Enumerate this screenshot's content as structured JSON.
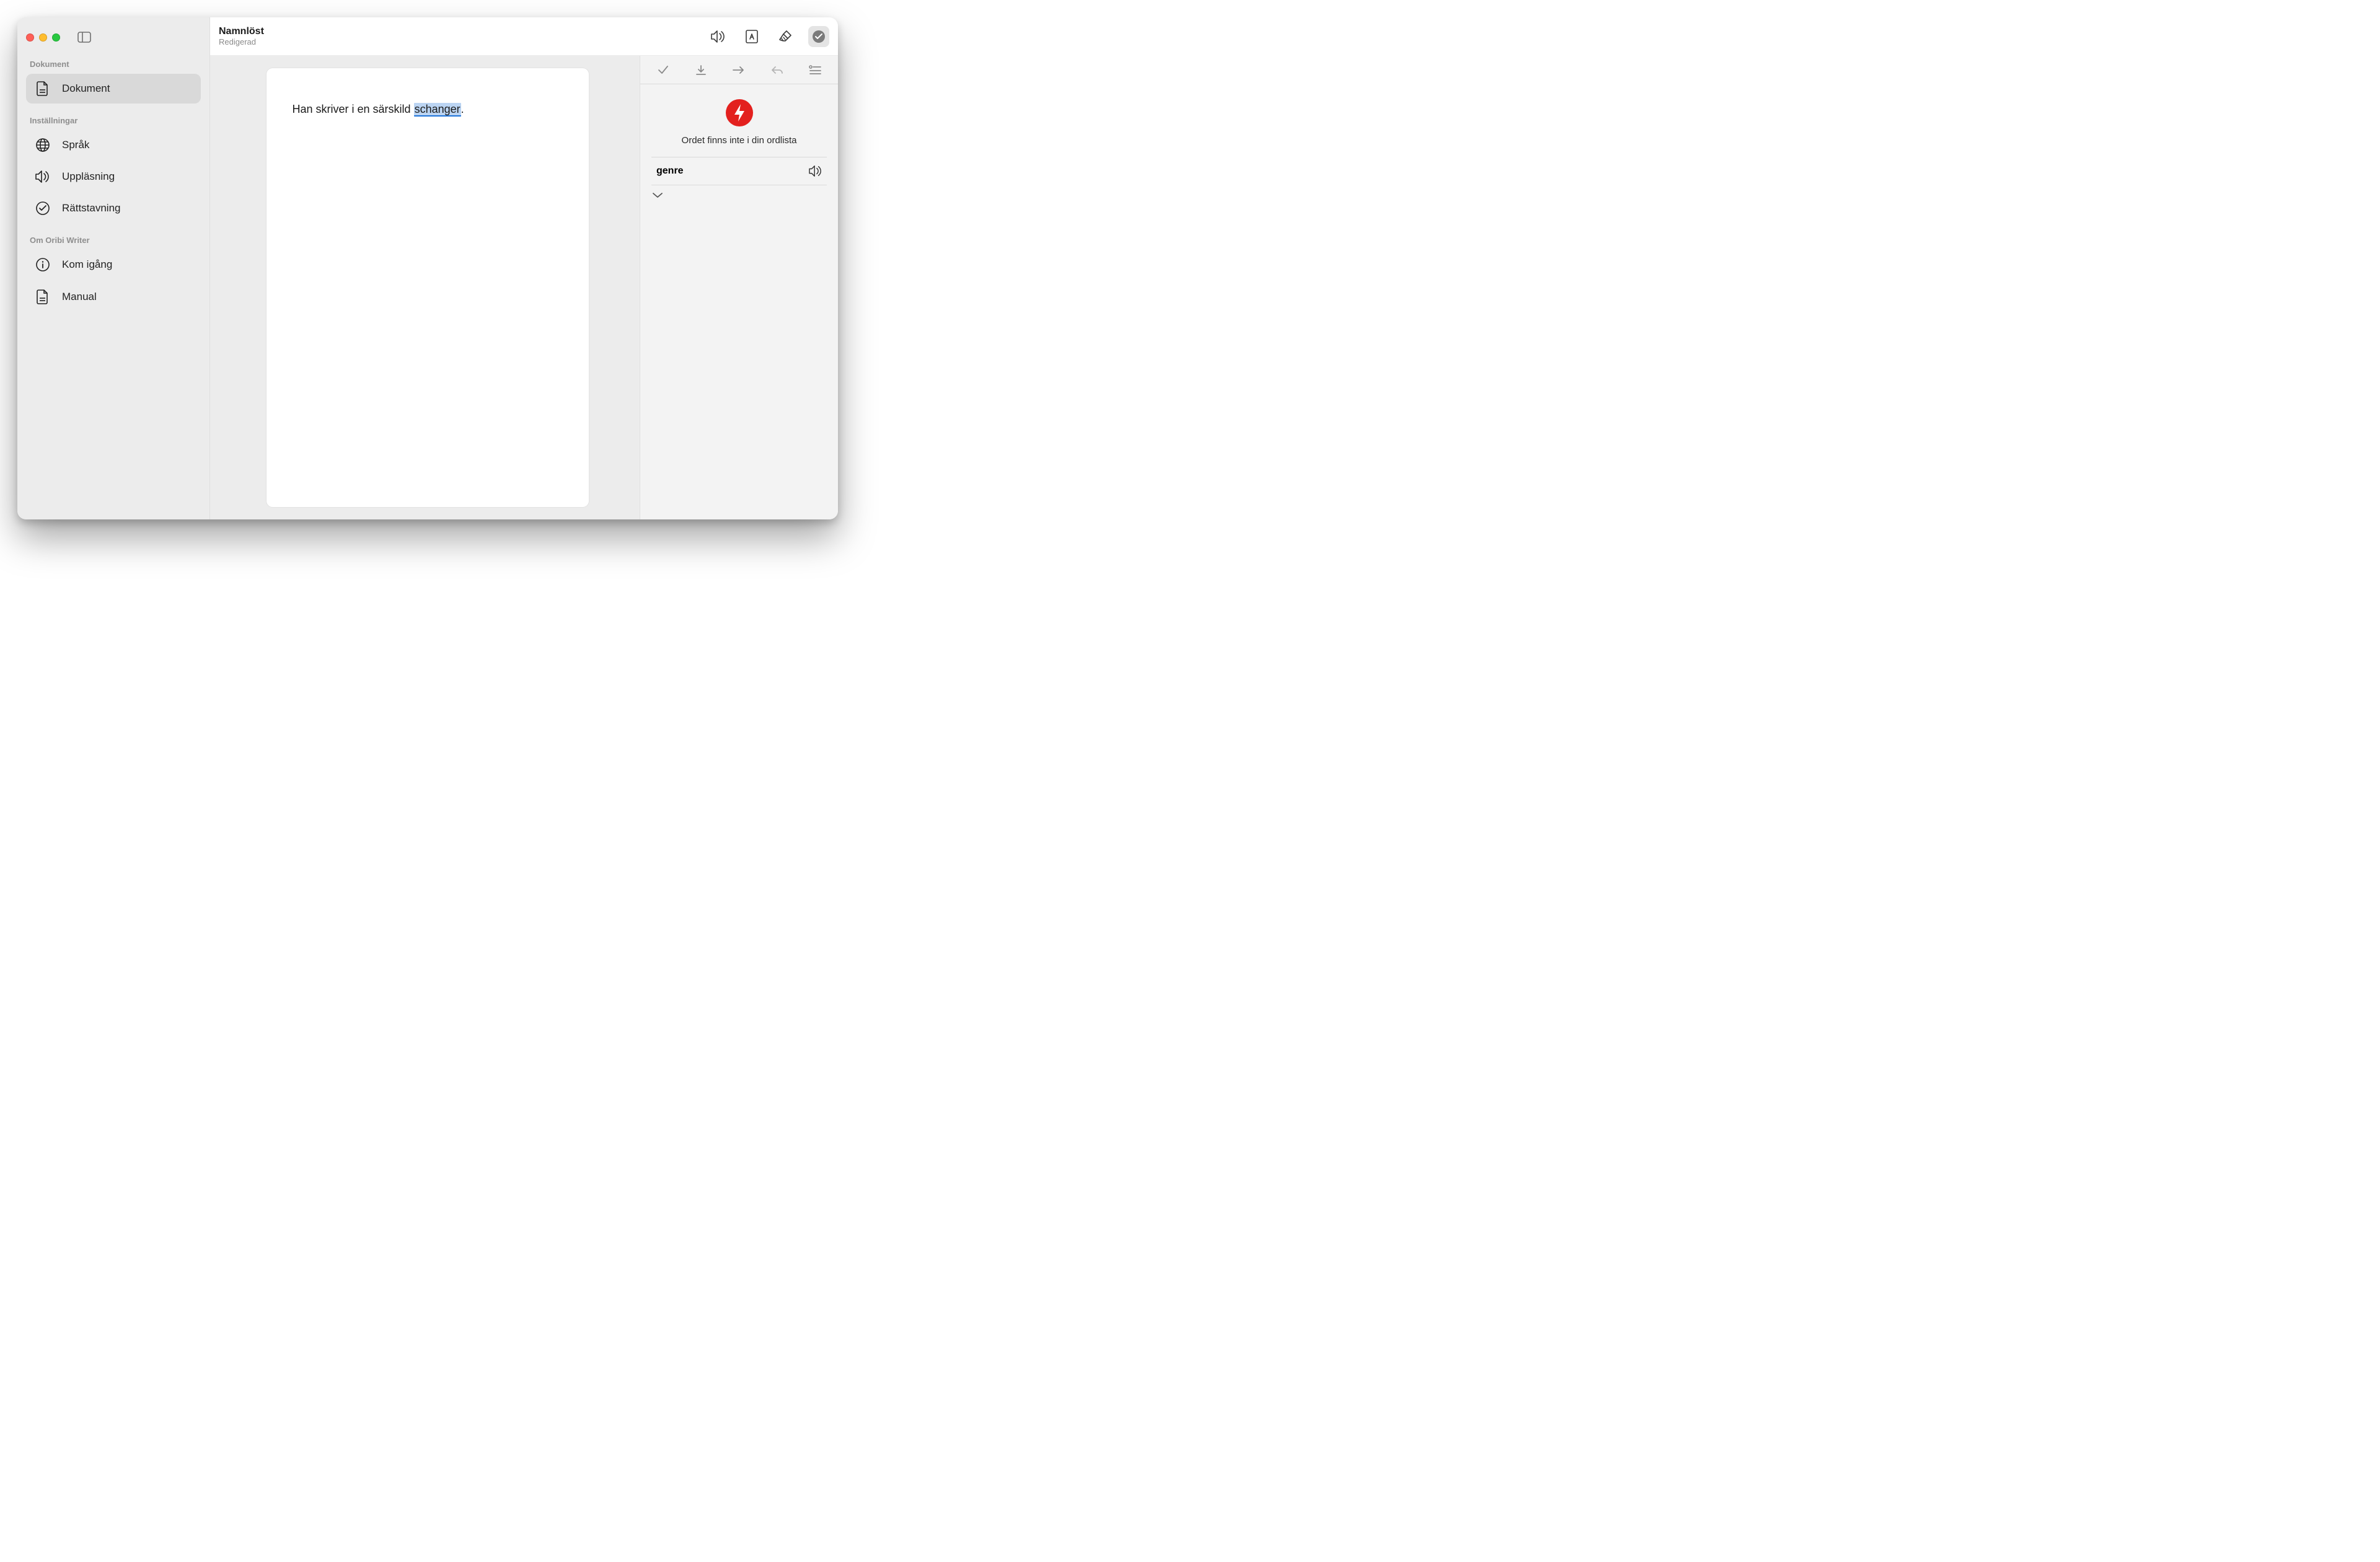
{
  "titlebar": {
    "title": "Namnlöst",
    "subtitle": "Redigerad"
  },
  "sidebar": {
    "sections": [
      {
        "label": "Dokument"
      },
      {
        "label": "Inställningar"
      },
      {
        "label": "Om Oribi Writer"
      }
    ],
    "items": {
      "dokument": "Dokument",
      "sprak": "Språk",
      "upplasning": "Uppläsning",
      "rattstavning": "Rättstavning",
      "kom_igang": "Kom igång",
      "manual": "Manual"
    }
  },
  "editor": {
    "text_before": "Han skriver i en särskild ",
    "highlighted": "schanger",
    "text_after": "."
  },
  "panel": {
    "message": "Ordet finns inte i din ordlista",
    "suggestion": "genre"
  }
}
